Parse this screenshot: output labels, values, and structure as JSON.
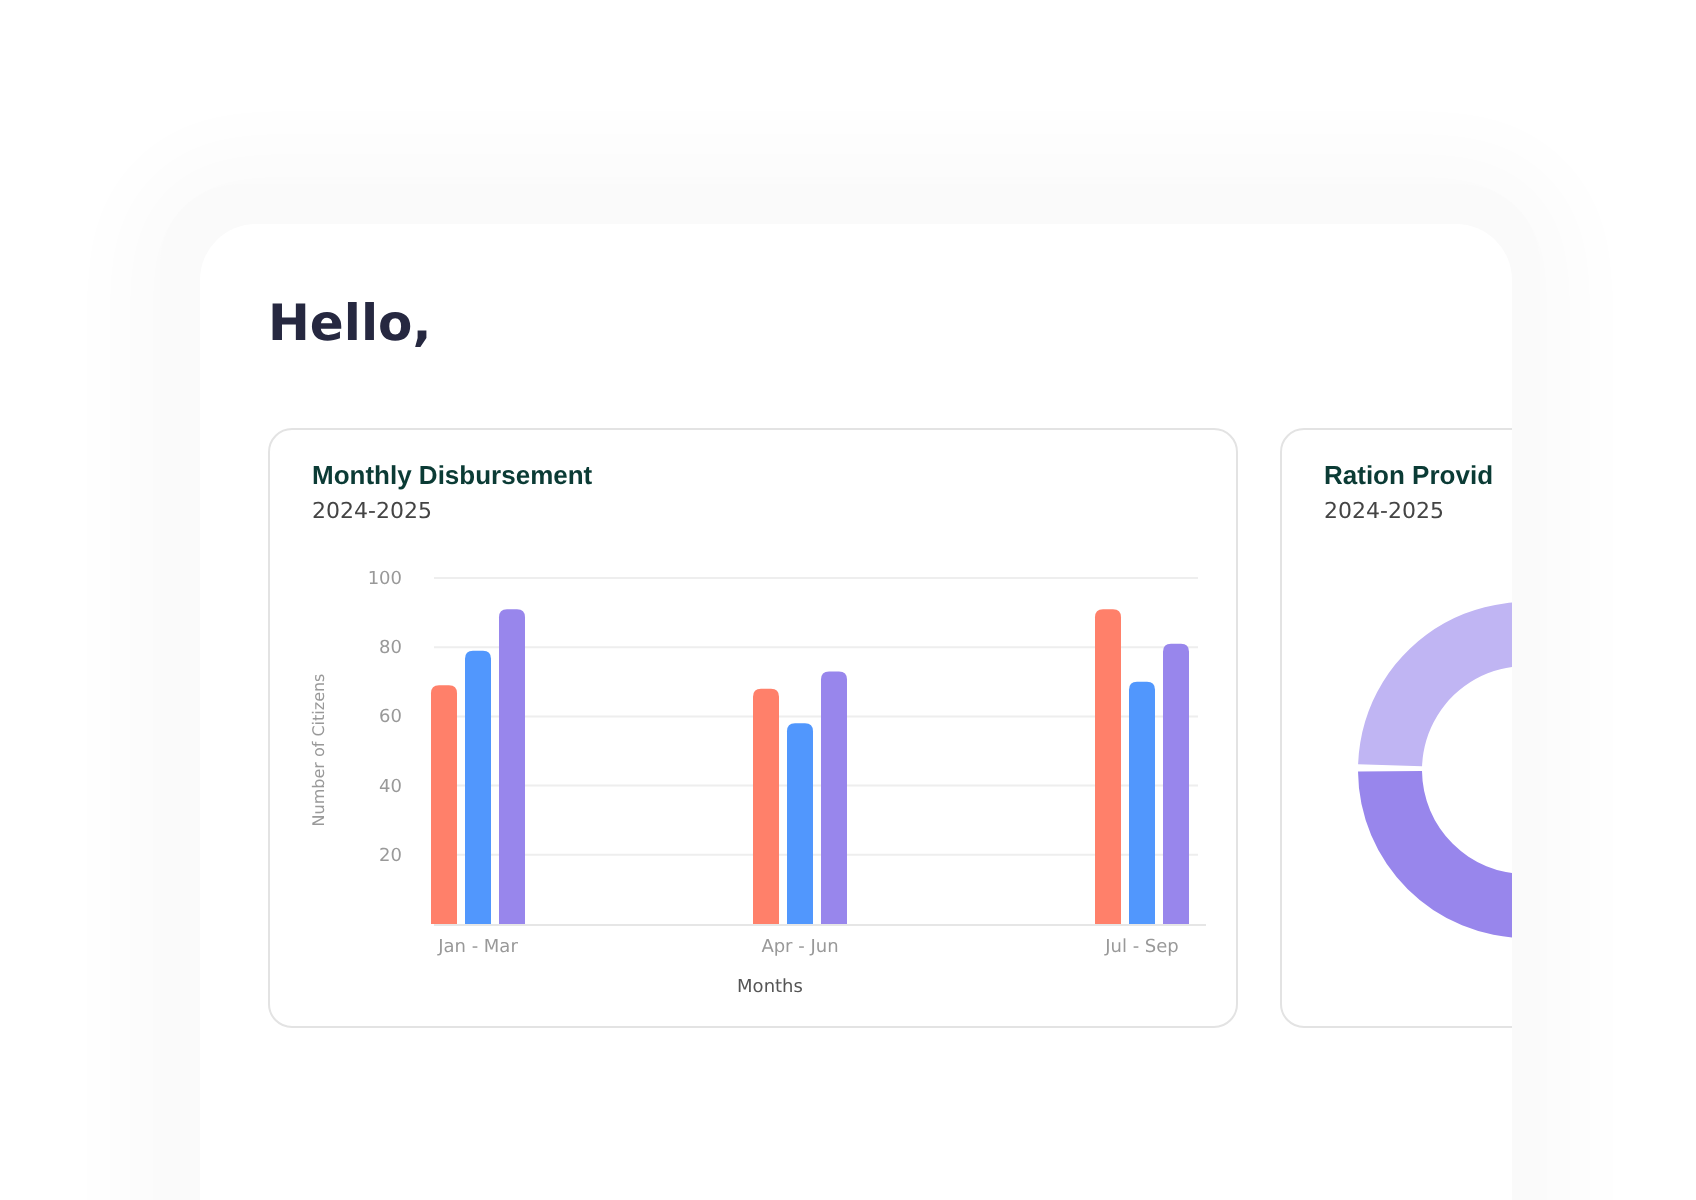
{
  "greeting": "Hello,",
  "cards": [
    {
      "kind": "bar",
      "title": "Monthly Disbursement",
      "subtitle": "2024-2025",
      "chart_data": {
        "type": "bar",
        "xlabel": "Months",
        "ylabel": "Number of Citizens",
        "categories": [
          "Jan - Mar",
          "Apr - Jun",
          "Jul - Sep"
        ],
        "series": [
          {
            "color": "#ff806a",
            "values": [
              69,
              68,
              91
            ]
          },
          {
            "color": "#5197fd",
            "values": [
              79,
              58,
              70
            ]
          },
          {
            "color": "#9886ec",
            "values": [
              91,
              73,
              81
            ]
          }
        ],
        "ylim": [
          0,
          100
        ],
        "yticks": [
          20,
          40,
          60,
          80,
          100
        ],
        "grid": true
      }
    },
    {
      "kind": "donut",
      "title": "Ration Provid",
      "subtitle": "2024-2025"
    }
  ]
}
